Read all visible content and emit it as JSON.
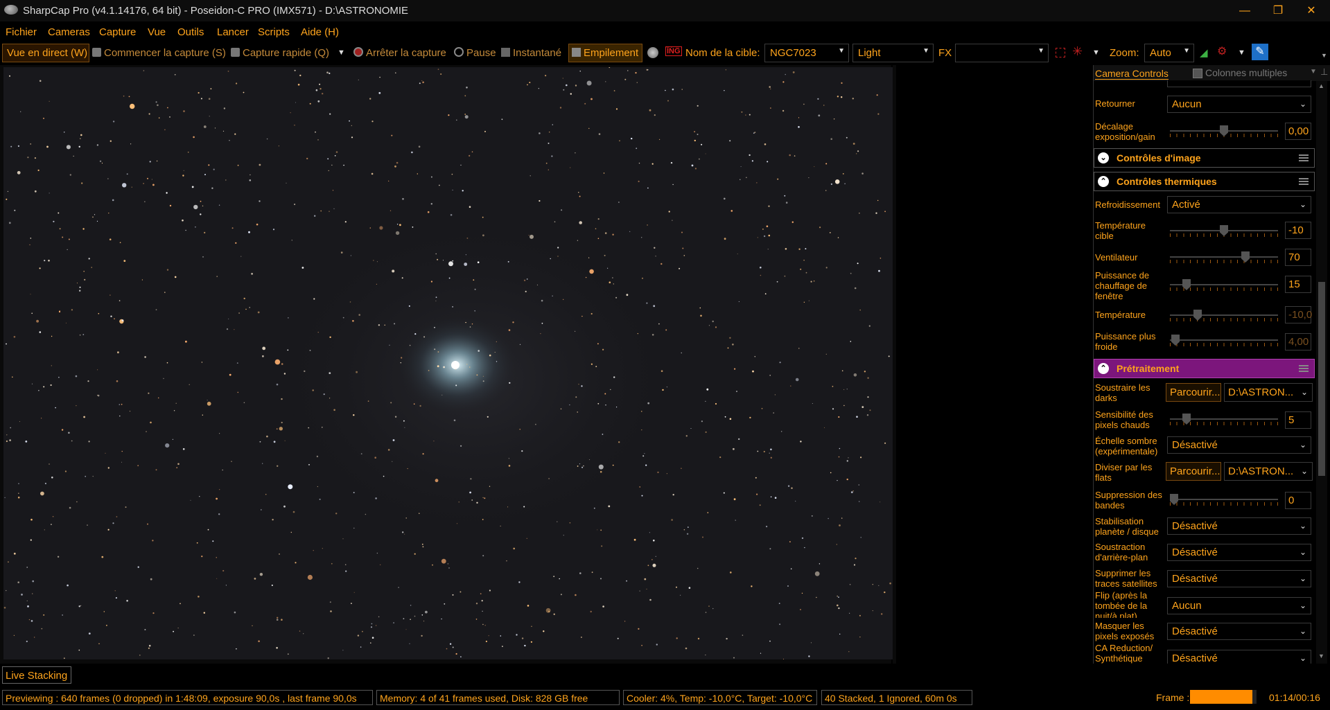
{
  "window": {
    "title": "SharpCap Pro (v4.1.14176, 64 bit) - Poseidon-C PRO (IMX571) - D:\\ASTRONOMIE",
    "minimize": "—",
    "restore": "❐",
    "close": "✕"
  },
  "menu": [
    "Fichier",
    "Cameras",
    "Capture",
    "Vue",
    "Outils",
    "Lancer",
    "Scripts",
    "Aide (H)"
  ],
  "toolbar": {
    "live_view": "Vue en direct (W)",
    "start_capture": "Commencer la capture (S)",
    "quick_capture": "Capture rapide (Q)",
    "stop_capture": "Arrêter la capture",
    "pause": "Pause",
    "snapshot": "Instantané",
    "stacking": "Empilement",
    "target_label": "Nom de la cible:",
    "target_value": "NGC7023",
    "frame_type": "Light",
    "fx_label": "FX",
    "fx_value": "",
    "zoom_label": "Zoom:",
    "zoom_value": "Auto"
  },
  "panel": {
    "title": "Camera Controls",
    "multi_columns": "Colonnes multiples",
    "flip_label": "Retourner",
    "flip_value": "Aucun",
    "offset_label": "Décalage exposition/gain",
    "offset_value": "0,00",
    "offset_level": 0.5,
    "image_controls": "Contrôles d'image",
    "thermal_controls": "Contrôles thermiques",
    "cooling_label": "Refroidissement",
    "cooling_value": "Activé",
    "target_temp_label": "Température cible",
    "target_temp_value": "-10",
    "fan_label": "Ventilateur",
    "fan_value": "70",
    "heater_label": "Puissance de chauffage de fenêtre",
    "heater_value": "15",
    "temp_label": "Température",
    "temp_value": "-10,0",
    "cooler_power_label": "Puissance plus froide",
    "cooler_power_value": "4,00",
    "preprocessing": "Prétraitement",
    "darks_label": "Soustraire les darks",
    "browse": "Parcourir...",
    "darks_path": "D:\\ASTRON...",
    "hotpix_label": "Sensibilité des pixels chauds",
    "hotpix_value": "5",
    "darkscale_label": "Échelle sombre (expérimentale)",
    "darkscale_value": "Désactivé",
    "flats_label": "Diviser par les flats",
    "flats_path": "D:\\ASTRON...",
    "banding_label": "Suppression des bandes",
    "banding_value": "0",
    "stab_label": "Stabilisation planète / disque",
    "stab_value": "Désactivé",
    "bg_label": "Soustraction d'arrière-plan",
    "bg_value": "Désactivé",
    "sat_label": "Supprimer les traces satellites",
    "sat_value": "Désactivé",
    "flip2_label": "Flip (après la tombée de la nuit/à plat)",
    "flip2_value": "Aucun",
    "mask_label": "Masquer les pixels exposés",
    "mask_value": "Désactivé",
    "ca_label": "CA Reduction/ Synthétique",
    "ca_value": "Désactivé"
  },
  "live_stacking_tab": "Live Stacking",
  "status": {
    "previewing": "Previewing : 640 frames (0 dropped) in 1:48:09, exposure 90,0s , last frame 90,0s",
    "memory": "Memory: 4 of 41 frames used, Disk: 828 GB free",
    "cooler": "Cooler: 4%, Temp: -10,0°C, Target: -10,0°C",
    "stacked": "40 Stacked, 1 Ignored, 60m 0s",
    "frame_label": "Frame :",
    "frame_progress": 0.94,
    "frame_time": "01:14/00:16"
  },
  "colors": {
    "accent": "#ffa41c",
    "preprocessing_bar": "#8a1a8a",
    "progress": "#ff8c00"
  }
}
